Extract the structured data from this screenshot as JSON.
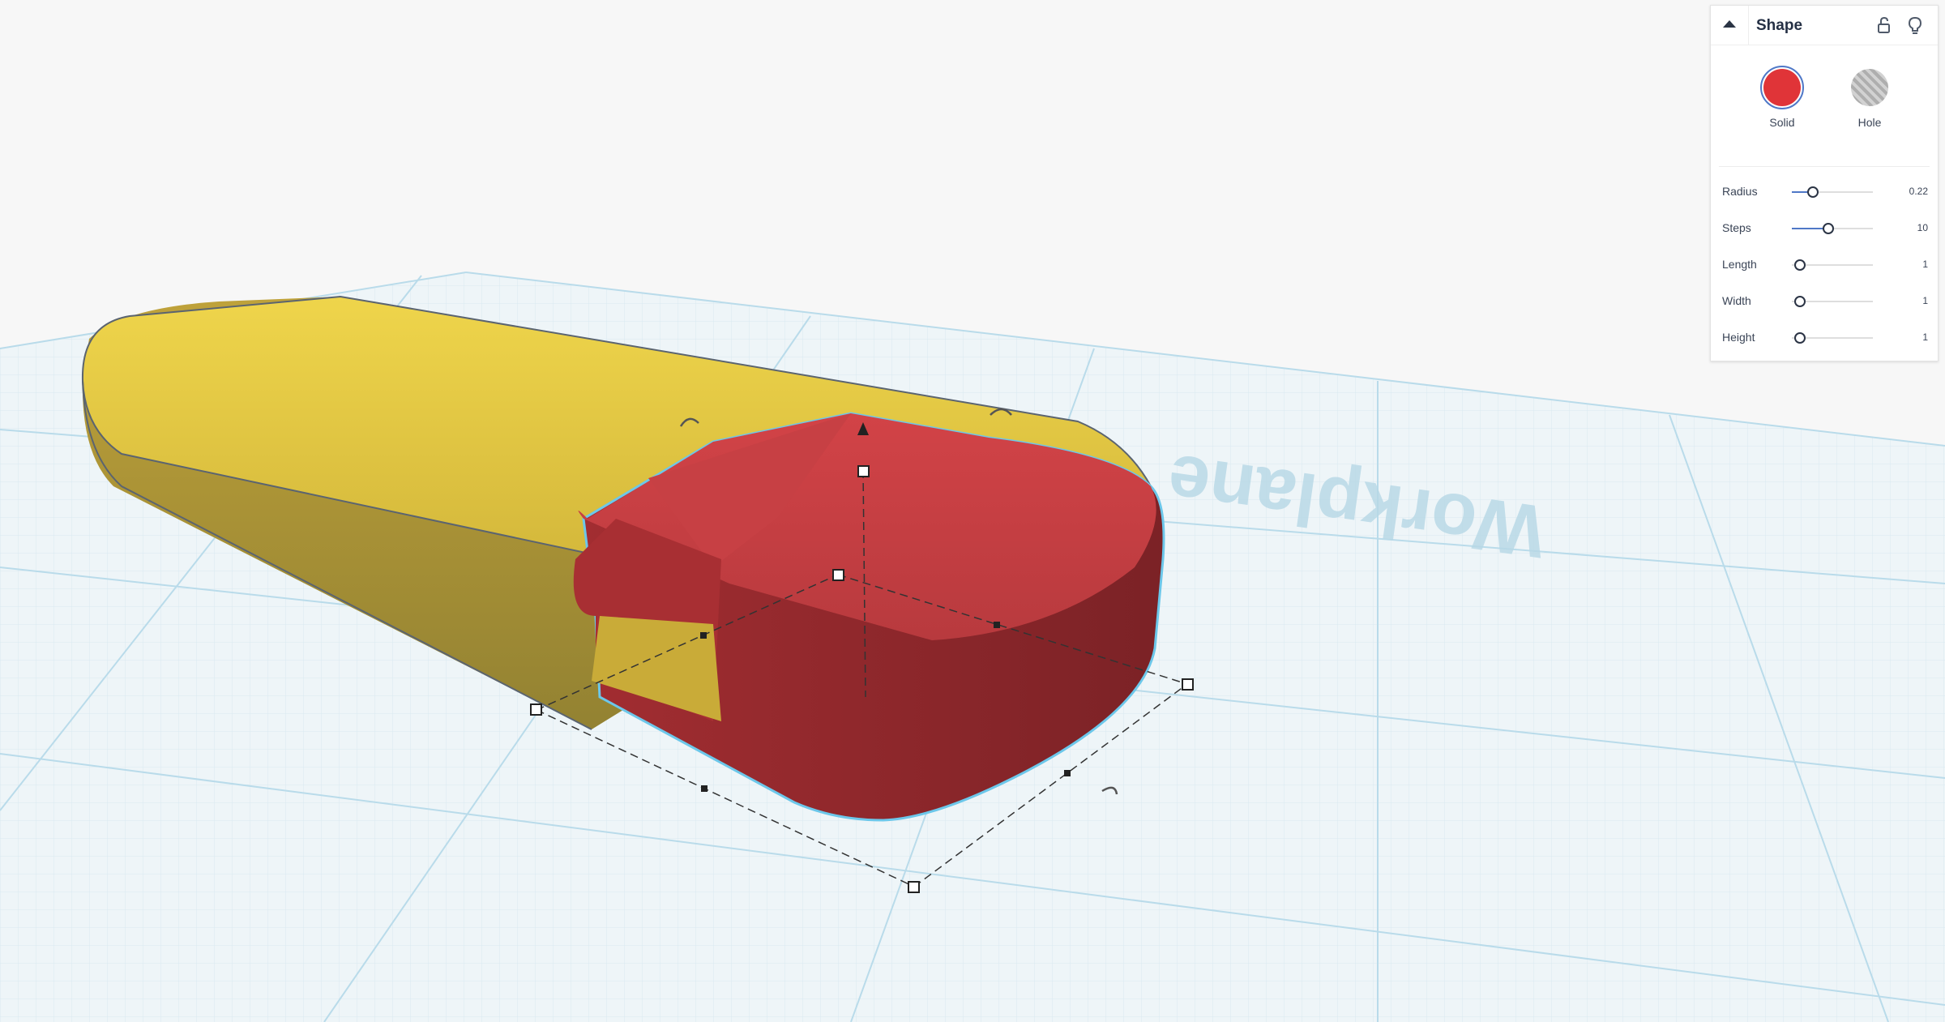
{
  "workplane": {
    "label": "Workplane"
  },
  "panel": {
    "title": "Shape",
    "materials": [
      {
        "label": "Solid",
        "color": "#e03438",
        "selected": true
      },
      {
        "label": "Hole",
        "color": "#b4b4b4",
        "selected": false
      }
    ],
    "properties": [
      {
        "label": "Radius",
        "value": "0.22",
        "level": 0.26
      },
      {
        "label": "Steps",
        "value": "10",
        "level": 0.45
      },
      {
        "label": "Length",
        "value": "1",
        "level": 0.1
      },
      {
        "label": "Width",
        "value": "1",
        "level": 0.1
      },
      {
        "label": "Height",
        "value": "1",
        "level": 0.1
      }
    ]
  },
  "colors": {
    "accent": "#4f78c7",
    "shape_yellow": "#e3c63e",
    "shape_red": "#c53b3f",
    "selection_outline": "#6cc7ea"
  }
}
